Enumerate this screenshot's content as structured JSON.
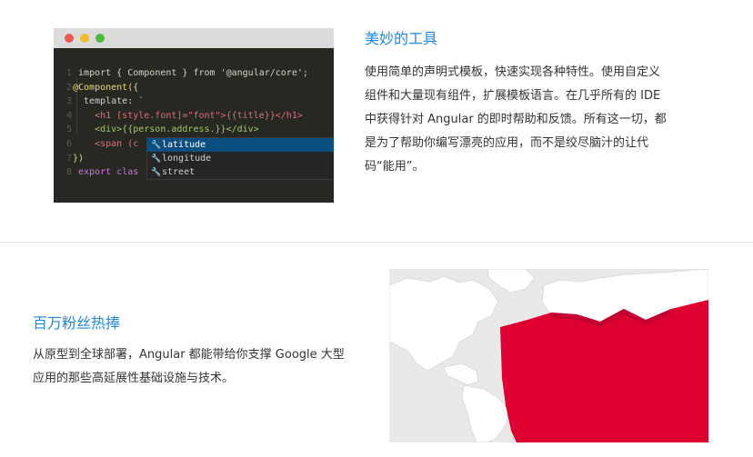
{
  "tools": {
    "title": "美妙的工具",
    "description": "使用简单的声明式模板，快速实现各种特性。使用自定义组件和大量现有组件，扩展模板语言。在几乎所有的 IDE 中获得针对 Angular 的即时帮助和反馈。所有这一切，都是为了帮助你编写漂亮的应用，而不是绞尽脑汁的让代码“能用”。",
    "code_lines": [
      {
        "num": "1",
        "text": "import { Component } from '@angular/core';"
      },
      {
        "num": "2",
        "text": "@Component({"
      },
      {
        "num": "3",
        "text": "  template: `"
      },
      {
        "num": "4",
        "text": "    <h1 [style.font]=\"font\">{{title}}</h1>"
      },
      {
        "num": "5",
        "text": "    <div>{{person.address.}}</div>"
      },
      {
        "num": "6",
        "text": "    <span (c"
      },
      {
        "num": "7",
        "text": "})"
      },
      {
        "num": "8",
        "text": "export clas"
      }
    ],
    "autocomplete": [
      "latitude",
      "longitude",
      "street"
    ]
  },
  "scale": {
    "title": "百万粉丝热捧",
    "description": "从原型到全球部署，Angular 都能带给你支撑 Google 大型应用的那些高延展性基础设施与技术。"
  },
  "colors": {
    "accent": "#1e88e5",
    "map_red": "#dd0031"
  }
}
